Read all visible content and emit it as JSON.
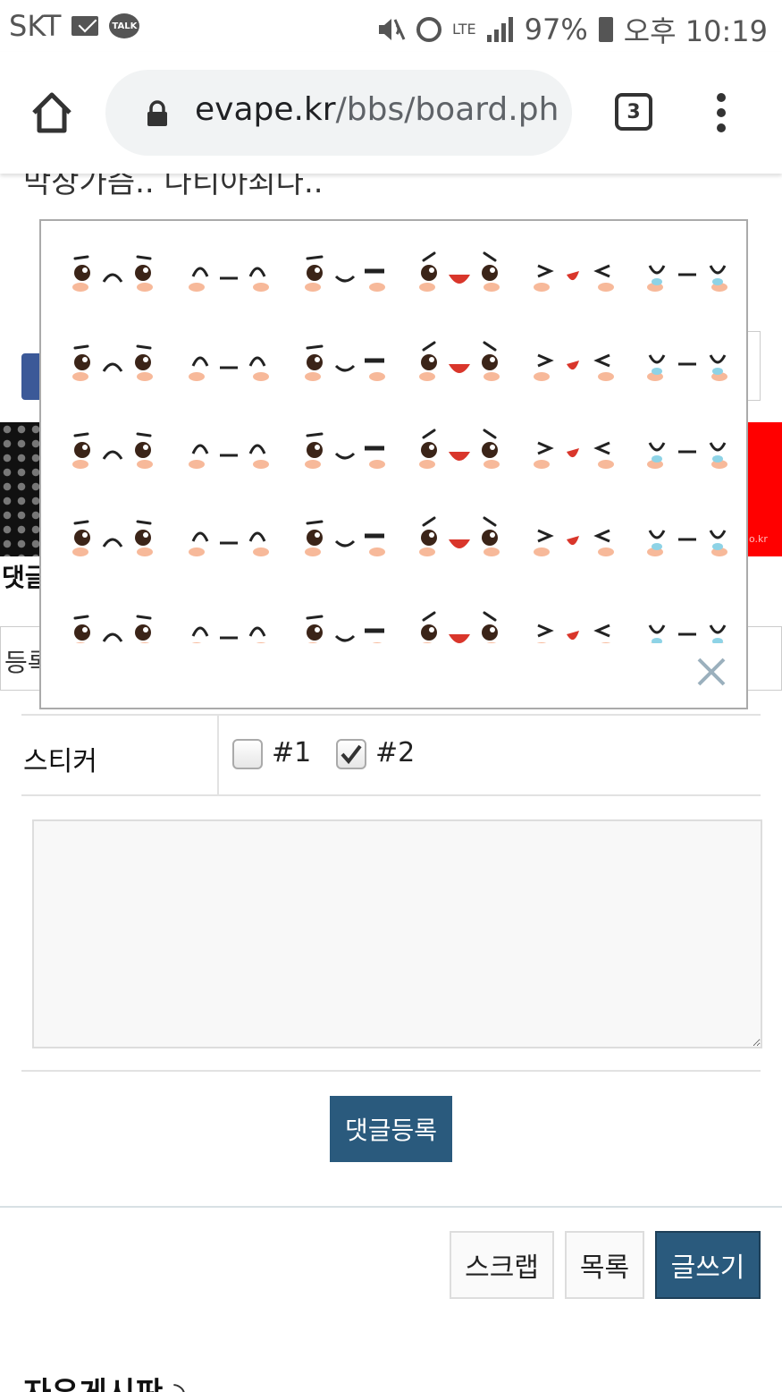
{
  "status_bar": {
    "carrier": "SKT",
    "talk_badge": "TALK",
    "network": "LTE",
    "battery": "97%",
    "time": "오후 10:19"
  },
  "browser": {
    "url_domain": "evape.kr",
    "url_path": "/bbs/board.ph",
    "tab_count": "3"
  },
  "page": {
    "cut_title": "막장가즘.. 나티아죄다..",
    "banner_text": "o.kr",
    "comment_heading": "댓글",
    "register_label": "등록"
  },
  "sticker": {
    "label": "스티커",
    "options": [
      {
        "label": "#1",
        "checked": false
      },
      {
        "label": "#2",
        "checked": true
      }
    ]
  },
  "comment_box": {
    "value": ""
  },
  "buttons": {
    "submit": "댓글등록",
    "scrap": "스크랩",
    "list": "목록",
    "write": "글쓰기"
  },
  "board_title": "자유게시판",
  "colors": {
    "primary_button": "#2a5a7d",
    "cheek": "#f7b99a",
    "mouth": "#d9362b",
    "tear": "#8ed3e6",
    "eye": "#3b2418"
  }
}
